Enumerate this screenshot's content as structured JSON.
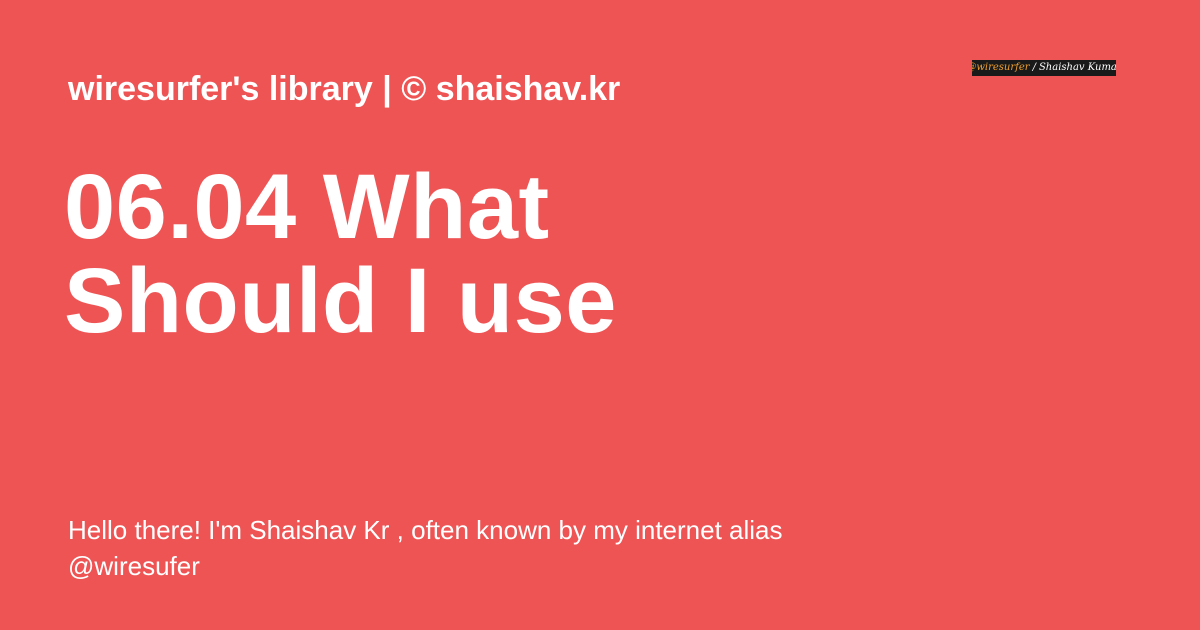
{
  "header": {
    "site_title": "wiresurfer's library | © shaishav.kr"
  },
  "main": {
    "heading": "06.04 What Should I use",
    "description": "Hello there! I'm Shaishav Kr , often known by my internet alias @wiresufer"
  },
  "logo": {
    "handle": "@wiresurfer",
    "separator": "/",
    "name": "Shaishav Kumar"
  },
  "colors": {
    "background": "#ef5455",
    "text": "#ffffff",
    "logo_background": "#1a1a1a",
    "logo_accent": "#f0a030"
  }
}
